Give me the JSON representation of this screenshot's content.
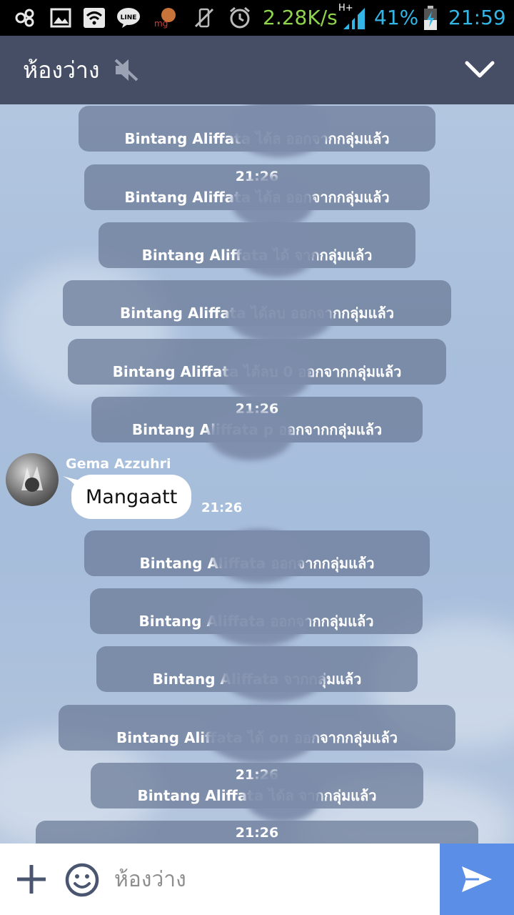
{
  "status_bar": {
    "network_speed": "2.28K/s",
    "network_type": "H+",
    "battery": "41%",
    "time": "21:59",
    "icons": [
      "app-icon",
      "image-icon",
      "wifi-icon",
      "line-app-icon",
      "mg-app-icon",
      "vibrate-off-icon",
      "alarm-icon",
      "signal-icon",
      "battery-charging-icon"
    ]
  },
  "header": {
    "title": "ห้องว่าง",
    "muted_icon": "mute-speaker-icon",
    "collapse_icon": "chevron-down-icon"
  },
  "messages": {
    "system": [
      {
        "time": "",
        "text": "Bintang Aliffata ได้ล                    ออกจากกลุ่มแล้ว"
      },
      {
        "time": "21:26",
        "text": "Bintang Aliffata ได้ล                   ออกจากกลุ่มแล้ว"
      },
      {
        "time": "",
        "text": "Bintang Aliffata ได้                   จากกลุ่มแล้ว"
      },
      {
        "time": "",
        "text": "Bintang Aliffata ได้ลบ                    ออกจากกลุ่มแล้ว"
      },
      {
        "time": "",
        "text": "Bintang Aliffata ได้ลบ                   0 ออกจากกลุ่มแล้ว"
      },
      {
        "time": "21:26",
        "text": "Bintang Aliffata                  p ออกจากกลุ่มแล้ว"
      },
      {
        "time": "",
        "text": "Bintang Aliffata                    ออกจากกลุ่มแล้ว"
      },
      {
        "time": "",
        "text": "Bintang Aliffata                     ออกจากกลุ่มแล้ว"
      },
      {
        "time": "",
        "text": "Bintang Aliffata                      จากกลุ่มแล้ว"
      },
      {
        "time": "",
        "text": "Bintang Aliffata ได้                      on ออกจากกลุ่มแล้ว"
      },
      {
        "time": "21:26",
        "text": "Bintang Aliffata ได้ล                    จากกลุ่มแล้ว"
      },
      {
        "time": "21:26",
        "text": ""
      }
    ],
    "user_message": {
      "sender": "Gema Azzuhri",
      "text": "Mangaatt",
      "time": "21:26"
    }
  },
  "input_bar": {
    "placeholder": "ห้องว่าง",
    "add_icon": "plus-icon",
    "emoji_icon": "smiley-icon",
    "send_icon": "send-arrow-icon"
  },
  "colors": {
    "header_bg": "#454e64",
    "send_button": "#5b8ee6",
    "system_bubble": "#6a7896",
    "network_text": "#8fd44b",
    "clock_text": "#33b5e5"
  }
}
